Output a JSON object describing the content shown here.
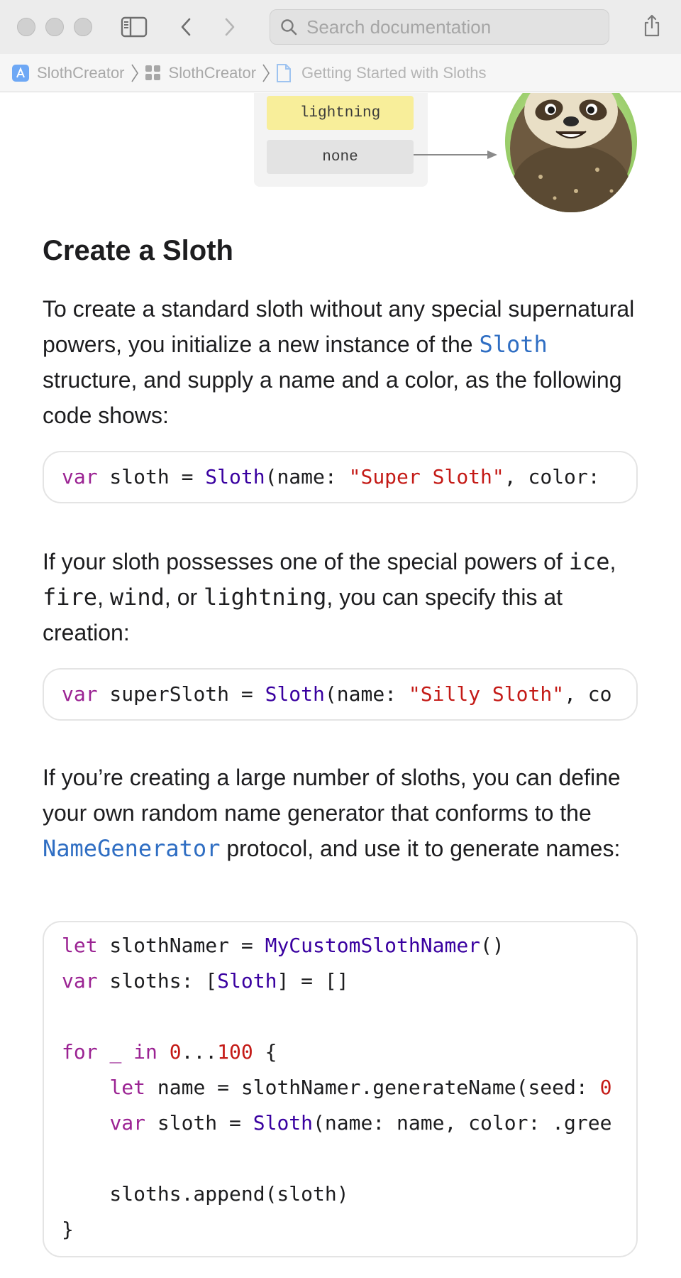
{
  "toolbar": {
    "search_placeholder": "Search documentation"
  },
  "breadcrumb": [
    {
      "label": "SlothCreator",
      "icon": "app-icon"
    },
    {
      "label": "SlothCreator",
      "icon": "framework-icon"
    },
    {
      "label": "Getting Started with Sloths",
      "icon": "article-icon"
    }
  ],
  "diagram": {
    "powers": [
      "lightning",
      "none"
    ]
  },
  "section": {
    "title": "Create a Sloth",
    "p1_a": "To create a standard sloth without any special supernatural powers, you initialize a new instance of the ",
    "p1_link": "Sloth",
    "p1_b": " structure, and supply a name and a color, as the following code shows:",
    "p2_a": "If your sloth possesses one of the special powers of ",
    "p2_ice": "ice",
    "p2_c1": ", ",
    "p2_fire": "fire",
    "p2_c2": ", ",
    "p2_wind": "wind",
    "p2_or": ", or ",
    "p2_lightning": "lightning",
    "p2_b": ", you can specify this at creation:",
    "p3_a": "If you’re creating a large number of sloths, you can define your own random name generator that conforms to the ",
    "p3_link": "NameGenerator",
    "p3_b": " protocol, and use it to generate names:"
  },
  "code1": {
    "kw": "var",
    "a": " sloth = ",
    "ty": "Sloth",
    "b": "(name: ",
    "str": "\"Super Sloth\"",
    "c": ", color: "
  },
  "code2": {
    "kw": "var",
    "a": " superSloth = ",
    "ty": "Sloth",
    "b": "(name: ",
    "str": "\"Silly Sloth\"",
    "c": ", co"
  },
  "code3": {
    "l1_kw": "let",
    "l1_a": " slothNamer = ",
    "l1_ty": "MyCustomSlothNamer",
    "l1_b": "()",
    "l2_kw": "var",
    "l2_a": " sloths: [",
    "l2_ty": "Sloth",
    "l2_b": "] = []",
    "l4_kw1": "for",
    "l4_a": " ",
    "l4_us": "_",
    "l4_b": " ",
    "l4_kw2": "in",
    "l4_c": " ",
    "l4_n1": "0",
    "l4_d": "...",
    "l4_n2": "100",
    "l4_e": " {",
    "l5_indent": "    ",
    "l5_kw": "let",
    "l5_a": " name = slothNamer.generateName(seed: ",
    "l5_n": "0",
    "l6_indent": "    ",
    "l6_kw": "var",
    "l6_a": " sloth = ",
    "l6_ty": "Sloth",
    "l6_b": "(name: name, color: .gree",
    "l8": "    sloths.append(sloth)",
    "l9": "}"
  }
}
